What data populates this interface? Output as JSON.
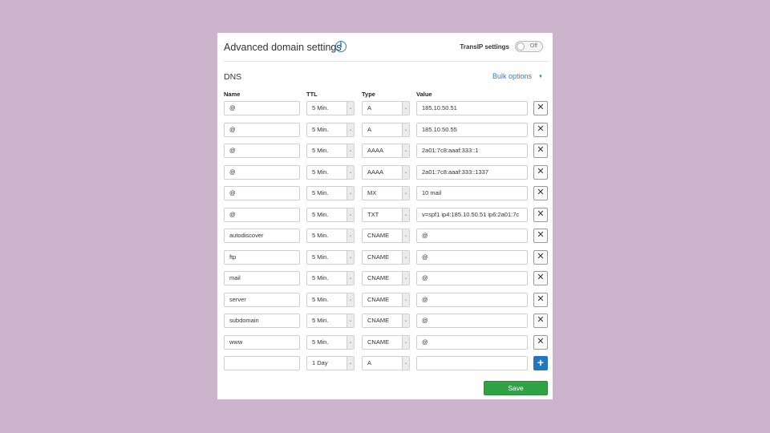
{
  "header": {
    "title": "Advanced domain settings",
    "info_icon": "i",
    "transip_label": "TransIP settings",
    "toggle_text": "Off"
  },
  "dns": {
    "title": "DNS",
    "bulk_options": "Bulk options",
    "bulk_caret": "▼"
  },
  "columns": {
    "name": "Name",
    "ttl": "TTL",
    "type": "Type",
    "value": "Value"
  },
  "records": [
    {
      "name": "@",
      "ttl": "5 Min.",
      "type": "A",
      "value": "185.10.50.51"
    },
    {
      "name": "@",
      "ttl": "5 Min.",
      "type": "A",
      "value": "185.10.50.55"
    },
    {
      "name": "@",
      "ttl": "5 Min.",
      "type": "AAAA",
      "value": "2a01:7c8:aaaf:333::1"
    },
    {
      "name": "@",
      "ttl": "5 Min.",
      "type": "AAAA",
      "value": "2a01:7c8:aaaf:333::1337"
    },
    {
      "name": "@",
      "ttl": "5 Min.",
      "type": "MX",
      "value": "10 mail"
    },
    {
      "name": "@",
      "ttl": "5 Min.",
      "type": "TXT",
      "value": "v=spf1 ip4:185.10.50.51 ip6:2a01:7c"
    },
    {
      "name": "autodiscover",
      "ttl": "5 Min.",
      "type": "CNAME",
      "value": "@"
    },
    {
      "name": "ftp",
      "ttl": "5 Min.",
      "type": "CNAME",
      "value": "@"
    },
    {
      "name": "mail",
      "ttl": "5 Min.",
      "type": "CNAME",
      "value": "@"
    },
    {
      "name": "server",
      "ttl": "5 Min.",
      "type": "CNAME",
      "value": "@"
    },
    {
      "name": "subdomain",
      "ttl": "5 Min.",
      "type": "CNAME",
      "value": "@"
    },
    {
      "name": "www",
      "ttl": "5 Min.",
      "type": "CNAME",
      "value": "@"
    }
  ],
  "new_record": {
    "name": "",
    "ttl": "1 Day",
    "type": "A",
    "value": ""
  },
  "icons": {
    "delete": "✕",
    "add": "+",
    "select_arrow": "⌄"
  },
  "save_label": "Save",
  "colors": {
    "background": "#cbb4cc",
    "link": "#2f7ec7",
    "add": "#2277c1",
    "save": "#2fa344"
  }
}
